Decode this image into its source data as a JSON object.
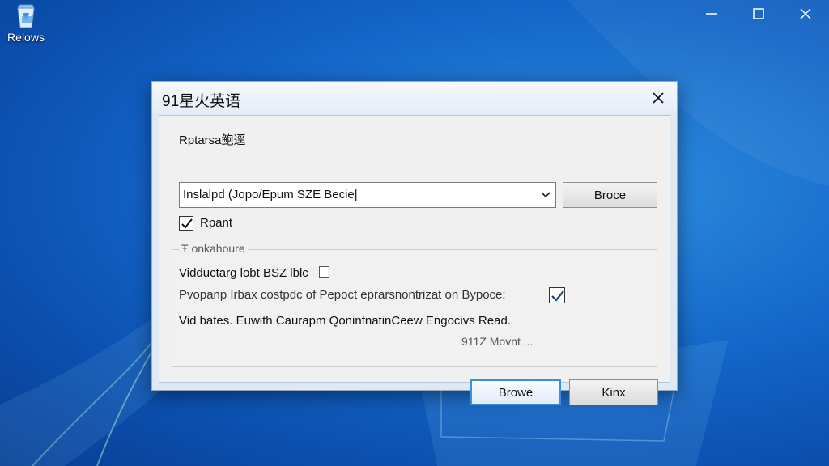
{
  "desktop": {
    "icon": {
      "name": "recycle-bin-icon",
      "label": "Relows"
    },
    "window_controls": [
      "minimize-icon",
      "maximize-icon",
      "close-icon"
    ]
  },
  "dialog": {
    "title": "91星火英语",
    "section_label": "Rptarsa鲍逕",
    "combo_value": "Inslalpd (Jopo/Epum SZE Becie|",
    "browse_button": "Broce",
    "checkbox_label": "Rpant",
    "group_title": "Ŧ onkahoure",
    "line1": "Vidductarg lobt BSZ lblc",
    "line2": "Pvopanp Irbax costpdc of Pepoct eprarsnontrizat on Bypoce:",
    "line3": "Vid bates. Euwith Caurapm QoninfnatinCeew Engocivs Read.",
    "status_text": "911Z Movnt ...",
    "ok_button": "Browe",
    "cancel_button": "Kinx"
  },
  "colors": {
    "accent": "#3c8fdd",
    "desktop": "#1466c8"
  }
}
